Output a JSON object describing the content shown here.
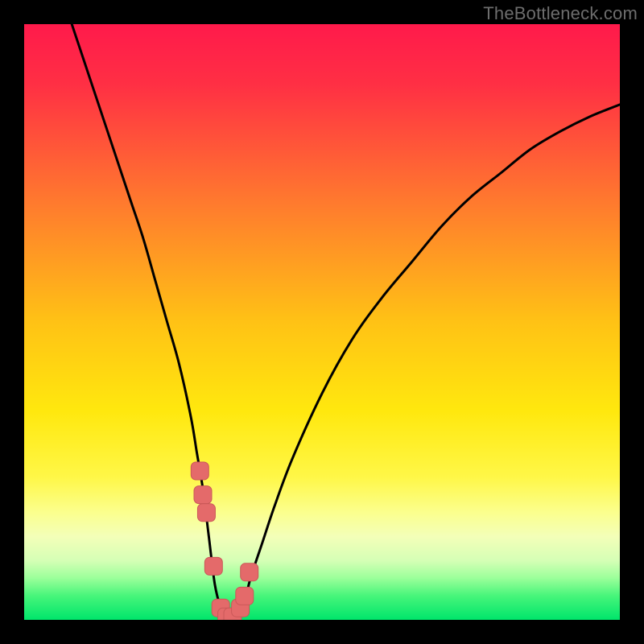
{
  "watermark": "TheBottleneck.com",
  "colors": {
    "frame": "#000000",
    "gradient_stops": [
      {
        "offset": 0.0,
        "color": "#ff1a4b"
      },
      {
        "offset": 0.1,
        "color": "#ff2f44"
      },
      {
        "offset": 0.3,
        "color": "#ff7a2e"
      },
      {
        "offset": 0.5,
        "color": "#ffc215"
      },
      {
        "offset": 0.65,
        "color": "#ffe80e"
      },
      {
        "offset": 0.76,
        "color": "#fff747"
      },
      {
        "offset": 0.82,
        "color": "#fbff8e"
      },
      {
        "offset": 0.86,
        "color": "#f3ffb8"
      },
      {
        "offset": 0.9,
        "color": "#d6ffb6"
      },
      {
        "offset": 0.93,
        "color": "#9bff9a"
      },
      {
        "offset": 0.96,
        "color": "#46f57a"
      },
      {
        "offset": 1.0,
        "color": "#00e56b"
      }
    ],
    "curve": "#000000",
    "marker_fill": "#e46a6a",
    "marker_stroke": "#ca5858"
  },
  "chart_data": {
    "type": "line",
    "title": "",
    "xlabel": "",
    "ylabel": "",
    "xlim": [
      0,
      100
    ],
    "ylim": [
      0,
      100
    ],
    "series": [
      {
        "name": "bottleneck-curve",
        "x": [
          8,
          10,
          12,
          14,
          16,
          18,
          20,
          22,
          24,
          26,
          28,
          29,
          30,
          31,
          32,
          33,
          34,
          35,
          36,
          37,
          38,
          40,
          42,
          45,
          50,
          55,
          60,
          65,
          70,
          75,
          80,
          85,
          90,
          95,
          100
        ],
        "values": [
          100,
          94,
          88,
          82,
          76,
          70,
          64,
          57,
          50,
          43,
          34,
          28,
          22,
          14,
          6,
          2,
          0,
          0,
          1,
          3,
          7,
          13,
          19,
          27,
          38,
          47,
          54,
          60,
          66,
          71,
          75,
          79,
          82,
          84.5,
          86.5
        ]
      }
    ],
    "markers": {
      "name": "highlighted-points",
      "x": [
        29.5,
        30.0,
        30.6,
        31.8,
        33.0,
        34.0,
        35.0,
        36.3,
        37.0,
        37.8
      ],
      "values": [
        25.0,
        21.0,
        18.0,
        9.0,
        2.0,
        0.5,
        0.5,
        2.0,
        4.0,
        8.0
      ]
    }
  }
}
